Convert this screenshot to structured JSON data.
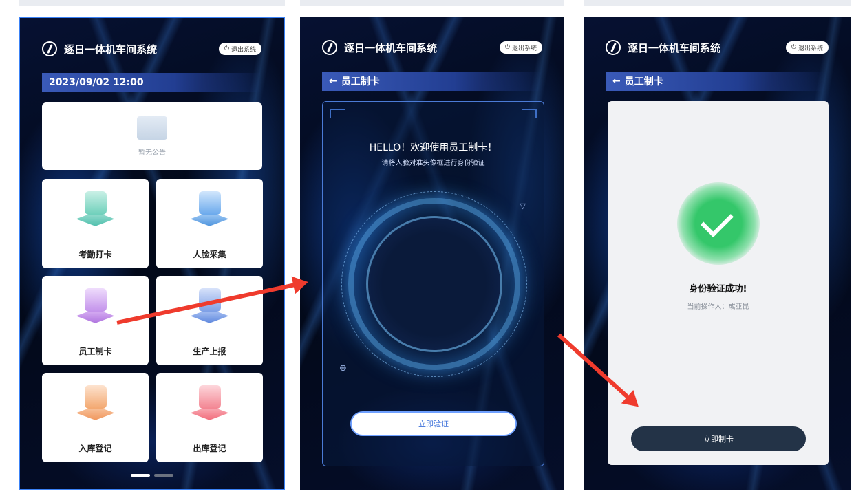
{
  "app": {
    "title": "逐日一体机车间系统",
    "exit_label": "退出系统"
  },
  "screen1": {
    "datetime": "2023/09/02  12:00",
    "notice_text": "暂无公告",
    "tiles": [
      {
        "label": "考勤打卡",
        "icon": "calendar-icon",
        "color": "#3cb7a4"
      },
      {
        "label": "人脸采集",
        "icon": "face-scan-icon",
        "color": "#3a87d8"
      },
      {
        "label": "员工制卡",
        "icon": "card-icon",
        "color": "#a463d9"
      },
      {
        "label": "生产上报",
        "icon": "document-icon",
        "color": "#4a78d8"
      },
      {
        "label": "入库登记",
        "icon": "house-in-icon",
        "color": "#ef8a4a"
      },
      {
        "label": "出库登记",
        "icon": "house-out-icon",
        "color": "#f05a6a"
      }
    ]
  },
  "screen2": {
    "back_title": "员工制卡",
    "hello": "HELLO！欢迎使用员工制卡！",
    "hint": "请将人脸对准头像框进行身份验证",
    "verify_button": "立即验证"
  },
  "screen3": {
    "back_title": "员工制卡",
    "success_title": "身份验证成功!",
    "operator": "当前操作人：成亚昆",
    "make_card_button": "立即制卡"
  },
  "annotation_color": "#ef3b2d"
}
